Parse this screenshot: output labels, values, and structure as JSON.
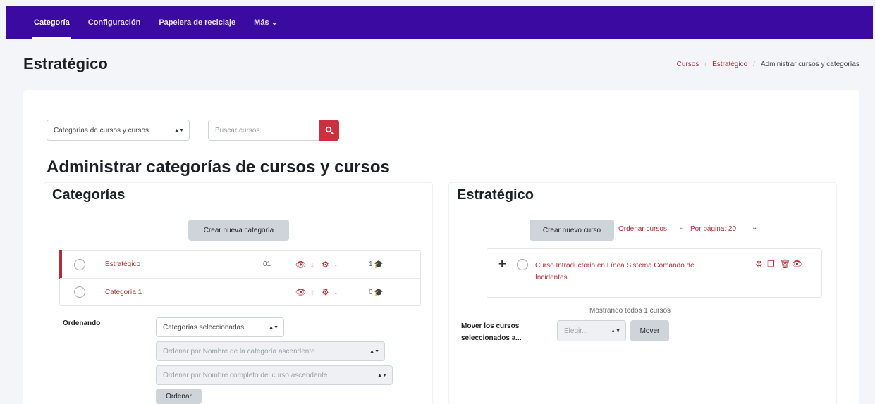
{
  "nav": {
    "items": [
      {
        "label": "Categoría"
      },
      {
        "label": "Configuración"
      },
      {
        "label": "Papelera de reciclaje"
      },
      {
        "label": "Más ⌄"
      }
    ]
  },
  "header": {
    "title": "Estratégico",
    "breadcrumb": [
      "Cursos",
      "Estratégico",
      "Administrar cursos y categorías"
    ]
  },
  "toolbar": {
    "view_select": "Categorías de cursos y cursos",
    "search_placeholder": "Buscar cursos"
  },
  "main": {
    "title": "Administrar categorías de cursos y cursos"
  },
  "categories_panel": {
    "heading": "Categorías",
    "create_button": "Crear nueva categoría",
    "rows": [
      {
        "name": "Estratégico",
        "id": "01",
        "count": "1"
      },
      {
        "name": "Categoría 1",
        "id": "",
        "count": "0"
      }
    ],
    "sort_label": "Ordenando",
    "sort_select": "Categorías seleccionadas",
    "sort_option_1": "Ordenar por Nombre de la categoría ascendente",
    "sort_option_2": "Ordenar por Nombre completo del curso ascendente",
    "sort_button": "Ordenar"
  },
  "courses_panel": {
    "heading": "Estratégico",
    "create_button": "Crear nuevo curso",
    "sort_link": "Ordenar cursos",
    "per_page": "Por página: 20",
    "course_line1": "Curso Introductorio en Línea Sistema Comando de",
    "course_line2": "Incidentes",
    "showing": "Mostrando todos 1 cursos",
    "move_label": "Mover los cursos seleccionados a...",
    "move_select": "Elegir...",
    "move_button": "Mover"
  },
  "colors": {
    "navbar": "#3b0aa0",
    "accent": "#b02e38",
    "search_button": "#cc2f3e"
  }
}
